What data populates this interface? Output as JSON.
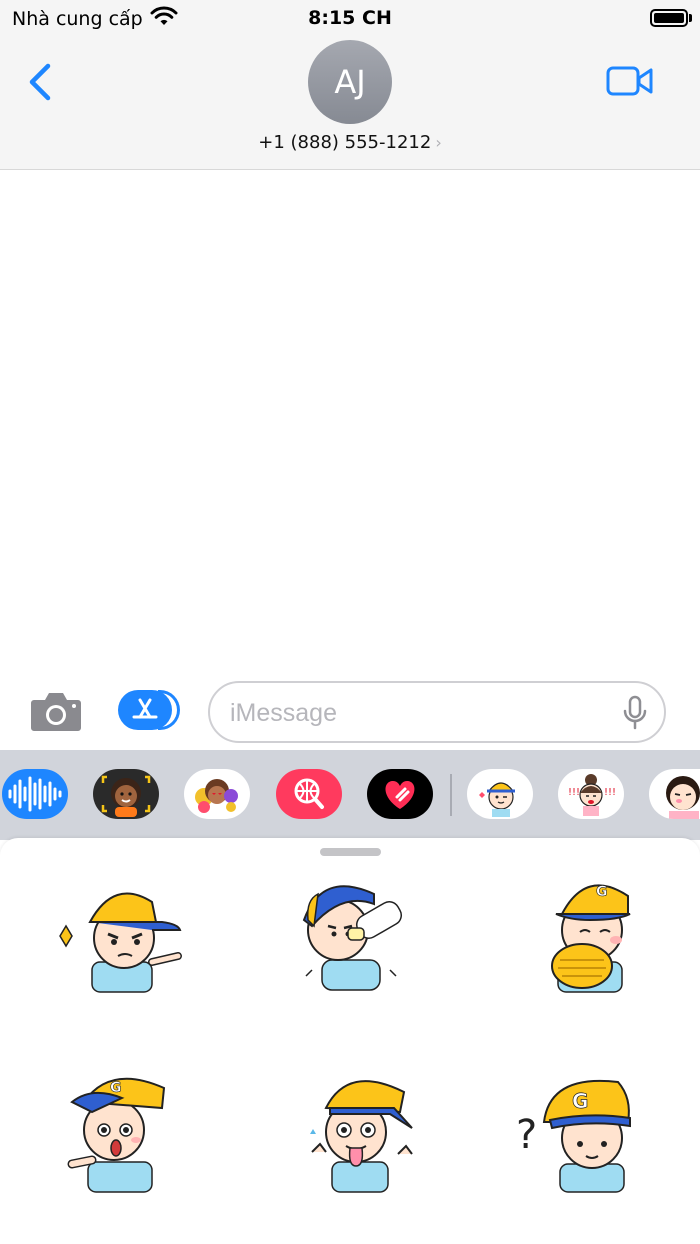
{
  "status_bar": {
    "carrier": "Nhà cung cấp",
    "time": "8:15 CH",
    "icons": [
      "wifi-icon",
      "battery-icon"
    ]
  },
  "header": {
    "back_icon": "chevron-left-icon",
    "avatar_initials": "AJ",
    "contact": "+1 (888) 555-1212",
    "contact_chevron": "›",
    "video_icon": "video-camera-icon"
  },
  "composer": {
    "camera_icon": "camera-icon",
    "apps_icon": "app-store-icon",
    "placeholder": "iMessage",
    "value": "",
    "mic_icon": "microphone-icon"
  },
  "app_drawer": {
    "apps": [
      {
        "name": "audio-message-app",
        "icon": "waveform-icon"
      },
      {
        "name": "memoji-app",
        "icon": "memoji-icon"
      },
      {
        "name": "memoji-stickers-app",
        "icon": "memoji-stickers-icon"
      },
      {
        "name": "image-search-app",
        "icon": "globe-search-icon"
      },
      {
        "name": "digital-touch-app",
        "icon": "heart-touch-icon"
      },
      {
        "name": "boy-sticker-app",
        "icon": "boy-sticker-icon"
      },
      {
        "name": "girl-sticker-app",
        "icon": "girl-sticker-icon"
      },
      {
        "name": "girl-sticker-app-2",
        "icon": "girl-sticker-icon"
      }
    ]
  },
  "sticker_panel": {
    "stickers": [
      {
        "name": "angry-boy-sticker"
      },
      {
        "name": "drinking-boy-sticker"
      },
      {
        "name": "clapping-boy-sticker"
      },
      {
        "name": "shocked-boy-sticker"
      },
      {
        "name": "tongue-out-boy-sticker"
      },
      {
        "name": "confused-boy-sticker"
      }
    ],
    "cap_letter": "G"
  },
  "colors": {
    "accent": "#1e86ff",
    "cap_yellow": "#fcc419",
    "cap_blue": "#2f5fd0",
    "shirt": "#9fdcf2",
    "skin": "#ffe3cf"
  }
}
